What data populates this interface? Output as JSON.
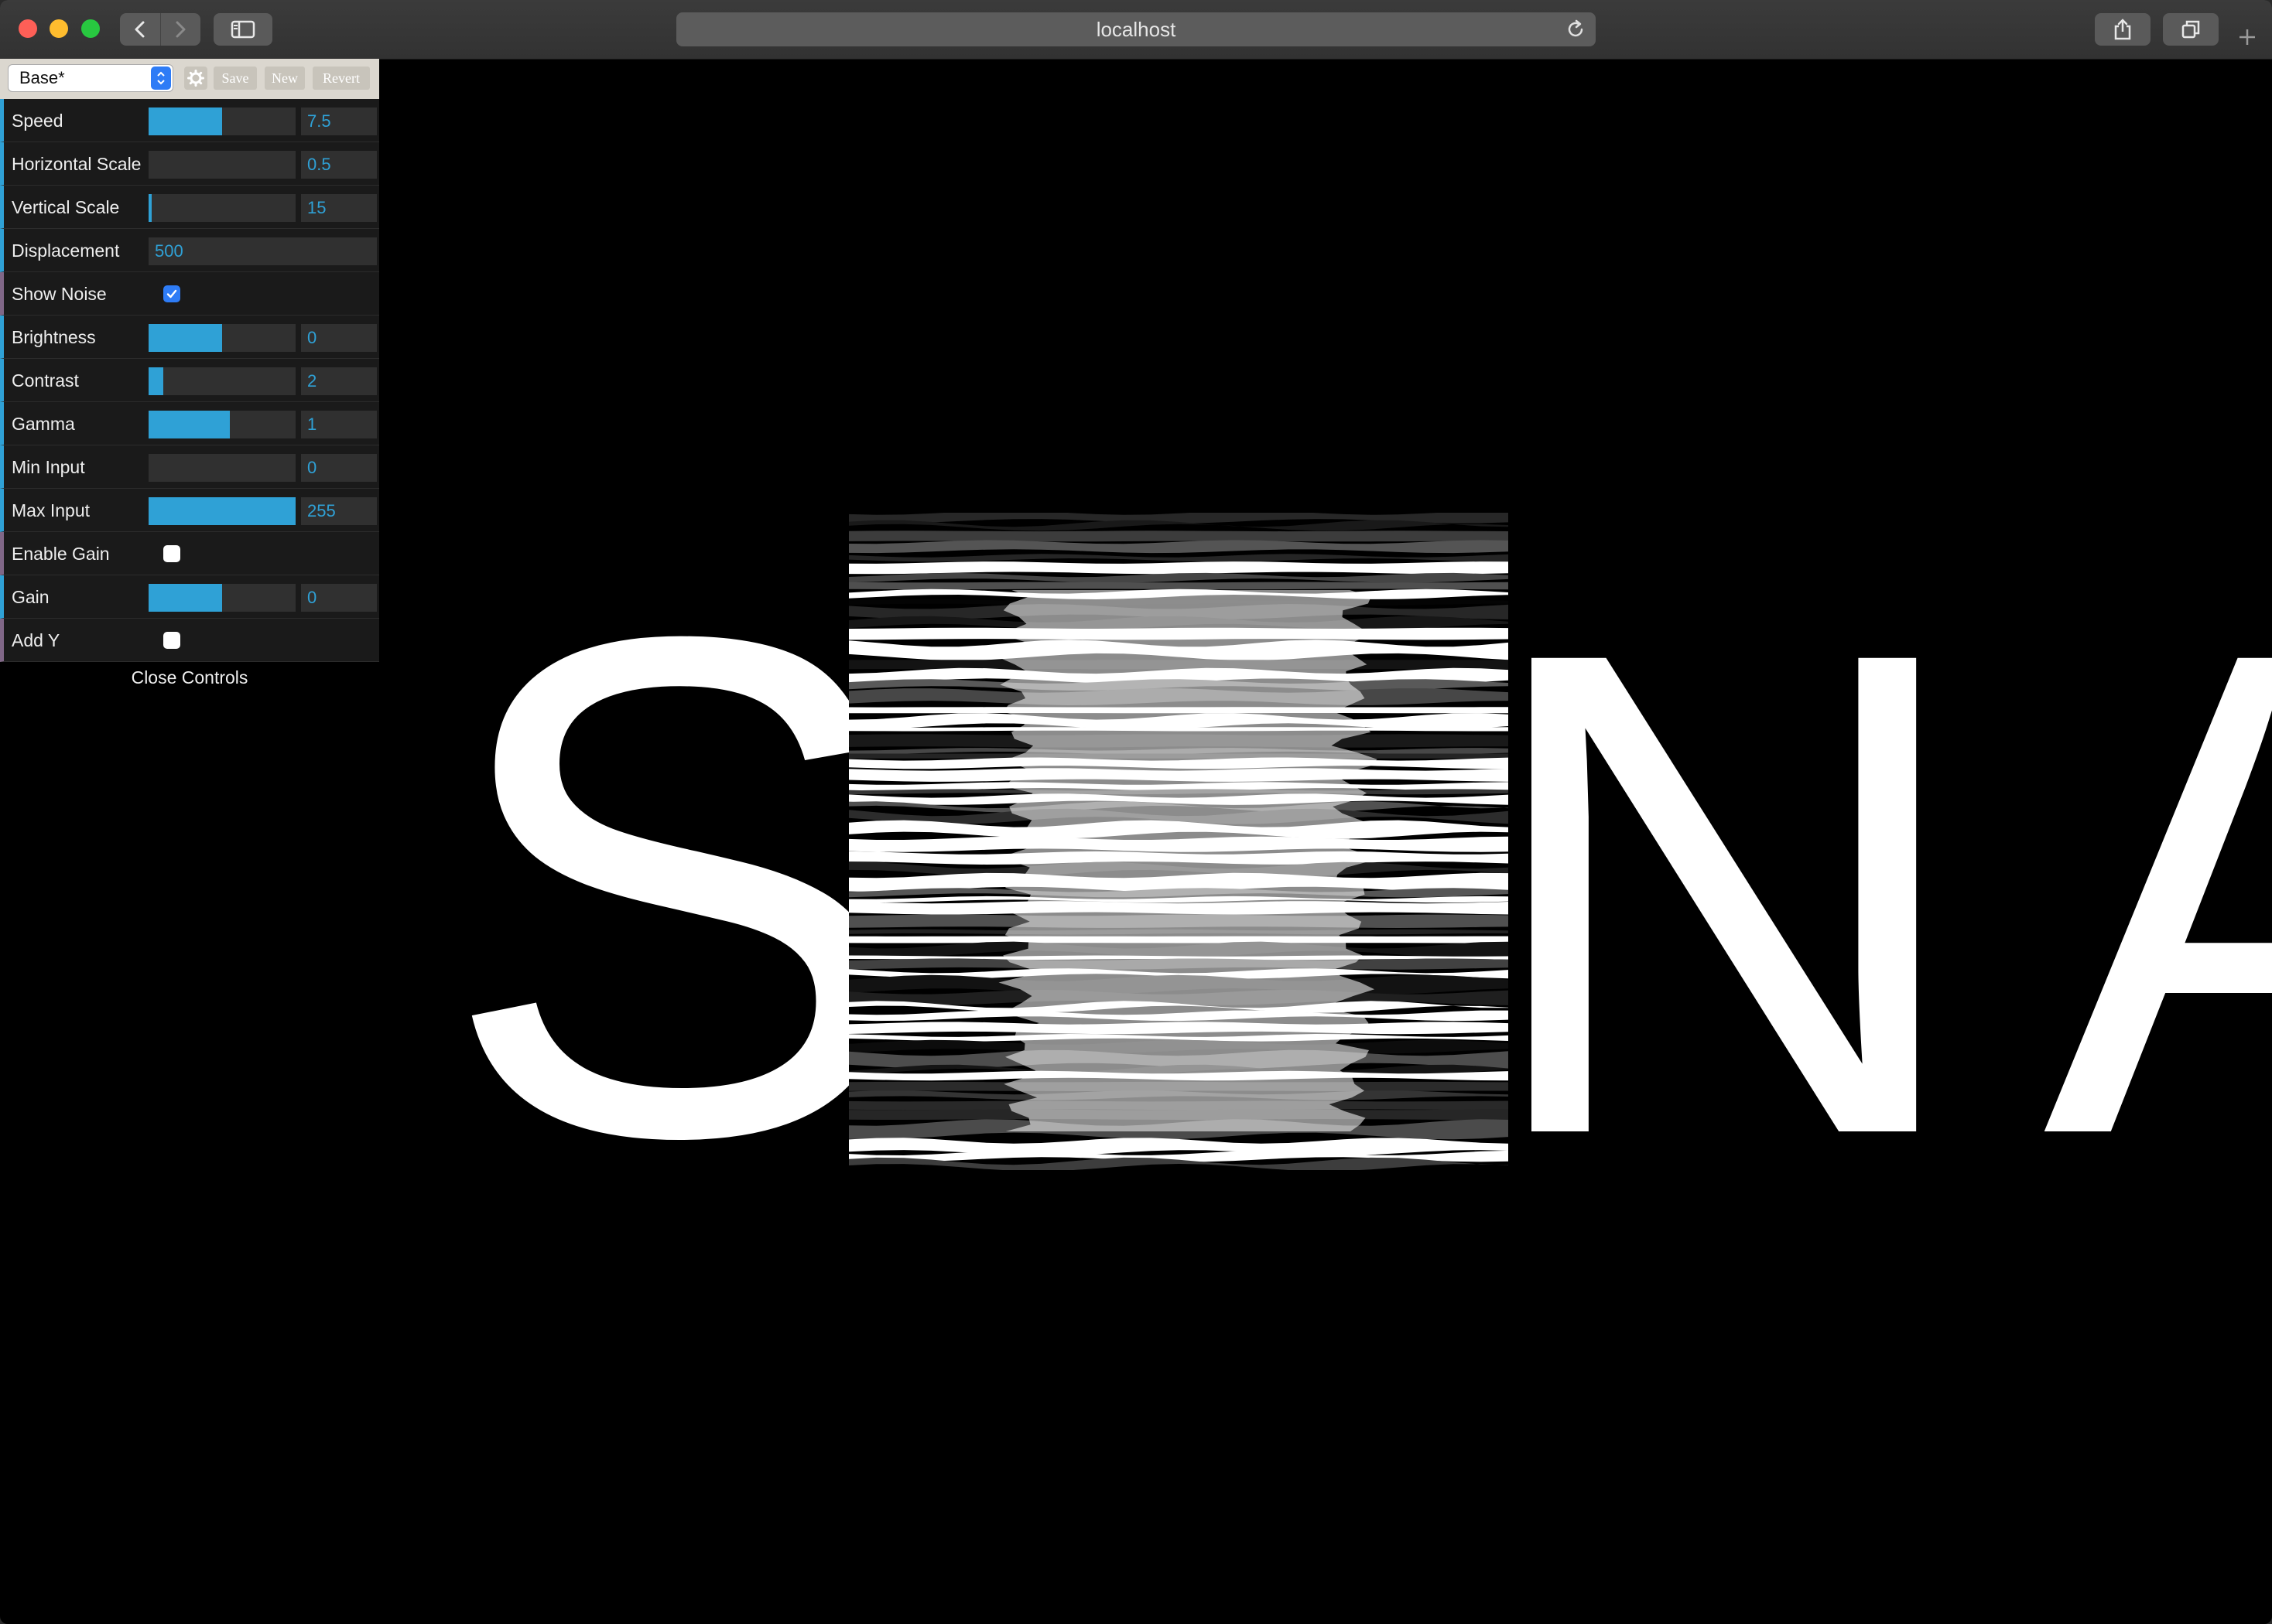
{
  "browser": {
    "url": "localhost"
  },
  "controls": {
    "preset": {
      "selected": "Base*",
      "save_label": "Save",
      "new_label": "New",
      "revert_label": "Revert"
    },
    "speed": {
      "label": "Speed",
      "value": "7.5",
      "fill": 0.5
    },
    "horizontal_scale": {
      "label": "Horizontal Scale",
      "value": "0.5",
      "fill": 0.0
    },
    "vertical_scale": {
      "label": "Vertical Scale",
      "value": "15",
      "fill": 0.02
    },
    "displacement": {
      "label": "Displacement",
      "value": "500"
    },
    "show_noise": {
      "label": "Show Noise",
      "checked": true
    },
    "brightness": {
      "label": "Brightness",
      "value": "0",
      "fill": 0.5
    },
    "contrast": {
      "label": "Contrast",
      "value": "2",
      "fill": 0.1
    },
    "gamma": {
      "label": "Gamma",
      "value": "1",
      "fill": 0.55
    },
    "min_input": {
      "label": "Min Input",
      "value": "0",
      "fill": 0.0
    },
    "max_input": {
      "label": "Max Input",
      "value": "255",
      "fill": 1.0
    },
    "enable_gain": {
      "label": "Enable Gain",
      "checked": false
    },
    "gain": {
      "label": "Gain",
      "value": "0",
      "fill": 0.5
    },
    "add_y": {
      "label": "Add Y",
      "checked": false
    },
    "close_label": "Close Controls"
  },
  "canvas": {
    "letters": [
      "S",
      "N",
      "A"
    ]
  },
  "colors": {
    "accent": "#2fa1d6",
    "checkbox": "#2e7cf6",
    "background": "#000000"
  }
}
